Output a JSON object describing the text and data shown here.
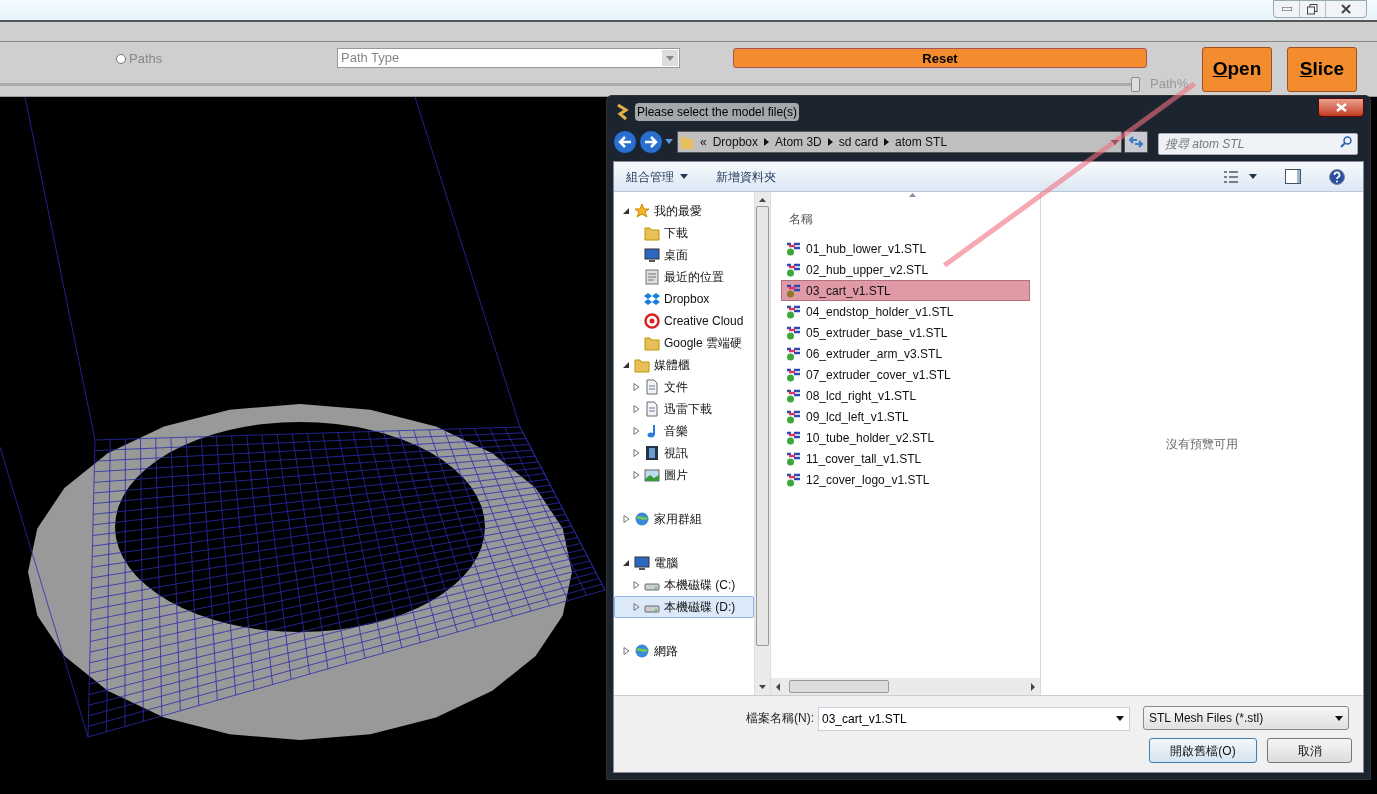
{
  "toolbar": {
    "paths_radio": {
      "label": "Paths",
      "checked": false
    },
    "path_type": {
      "placeholder": "Path Type"
    },
    "reset_button": "Reset",
    "path_slider": {
      "level": 1.0,
      "label": "Path%"
    },
    "buttons": [
      {
        "label": "Open"
      },
      {
        "label": "Slice"
      }
    ]
  },
  "dialog": {
    "title": "Please select the model file(s)",
    "breadcrumb": [
      "«",
      "Dropbox",
      "Atom 3D",
      "sd card",
      "atom STL"
    ],
    "search": {
      "placeholder": "搜尋 atom STL"
    },
    "commands": [
      {
        "label": "組合管理",
        "dropdown": true
      },
      {
        "label": "新增資料夾",
        "dropdown": false
      }
    ],
    "nav": [
      {
        "label": "我的最愛",
        "expanded": true,
        "selected": false,
        "children": [
          {
            "label": "下載",
            "selected": false
          },
          {
            "label": "桌面",
            "selected": false
          },
          {
            "label": "最近的位置",
            "selected": false
          },
          {
            "label": "Dropbox",
            "selected": false
          },
          {
            "label": "Creative Cloud",
            "selected": false
          },
          {
            "label": "Google 雲端硬",
            "selected": false
          }
        ]
      },
      {
        "label": "媒體櫃",
        "expanded": true,
        "selected": false,
        "children": [
          {
            "label": "文件",
            "expanded": false,
            "selected": false
          },
          {
            "label": "迅雷下載",
            "expanded": false,
            "selected": false
          },
          {
            "label": "音樂",
            "expanded": false,
            "selected": false
          },
          {
            "label": "視訊",
            "expanded": false,
            "selected": false
          },
          {
            "label": "圖片",
            "expanded": false,
            "selected": false
          }
        ]
      },
      {
        "label": "家用群組",
        "expanded": false,
        "selected": false
      },
      {
        "label": "電腦",
        "expanded": true,
        "selected": false,
        "children": [
          {
            "label": "本機磁碟 (C:)",
            "expanded": false,
            "selected": false
          },
          {
            "label": "本機磁碟 (D:)",
            "expanded": false,
            "selected": true
          }
        ]
      },
      {
        "label": "網路",
        "expanded": false,
        "selected": false
      }
    ],
    "column_header": "名稱",
    "files": [
      {
        "name": "01_hub_lower_v1.STL",
        "selected": false
      },
      {
        "name": "02_hub_upper_v2.STL",
        "selected": false
      },
      {
        "name": "03_cart_v1.STL",
        "selected": true
      },
      {
        "name": "04_endstop_holder_v1.STL",
        "selected": false
      },
      {
        "name": "05_extruder_base_v1.STL",
        "selected": false
      },
      {
        "name": "06_extruder_arm_v3.STL",
        "selected": false
      },
      {
        "name": "07_extruder_cover_v1.STL",
        "selected": false
      },
      {
        "name": "08_lcd_right_v1.STL",
        "selected": false
      },
      {
        "name": "09_lcd_left_v1.STL",
        "selected": false
      },
      {
        "name": "10_tube_holder_v2.STL",
        "selected": false
      },
      {
        "name": "11_cover_tall_v1.STL",
        "selected": false
      },
      {
        "name": "12_cover_logo_v1.STL",
        "selected": false
      }
    ],
    "preview_text": "沒有預覽可用",
    "filename_label": "檔案名稱(N):",
    "filename_value": "03_cart_v1.STL",
    "filter": "STL Mesh Files (*.stl)",
    "open_button": "開啟舊檔(O)",
    "cancel_button": "取消"
  }
}
